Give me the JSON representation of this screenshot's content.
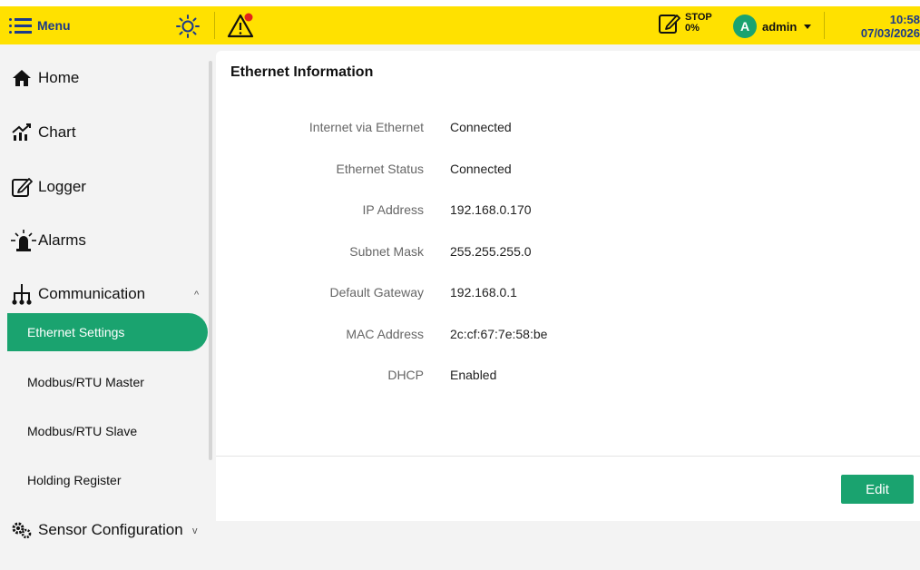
{
  "colors": {
    "topbar": "#ffe100",
    "accent": "#1aa36f",
    "menu_text": "#1c3a8a"
  },
  "header": {
    "menu_label": "Menu",
    "brightness_icon": "sun-icon",
    "alarm_icon": "warning-icon",
    "recording": {
      "status": "STOP",
      "percent": "0%"
    },
    "user": {
      "initial": "A",
      "name": "admin"
    },
    "time": "10:58",
    "date": "07/03/2026"
  },
  "sidebar": {
    "home": "Home",
    "chart": "Chart",
    "logger": "Logger",
    "alarms": "Alarms",
    "communication": "Communication",
    "sub_items": [
      "Ethernet Settings",
      "Modbus/RTU Master",
      "Modbus/RTU Slave",
      "Holding Register"
    ],
    "sensor_config": "Sensor Configuration"
  },
  "main": {
    "title": "Ethernet Information",
    "rows": [
      {
        "label": "Internet via Ethernet",
        "value": "Connected"
      },
      {
        "label": "Ethernet Status",
        "value": "Connected"
      },
      {
        "label": "IP Address",
        "value": "192.168.0.170"
      },
      {
        "label": "Subnet Mask",
        "value": "255.255.255.0"
      },
      {
        "label": "Default Gateway",
        "value": "192.168.0.1"
      },
      {
        "label": "MAC Address",
        "value": "2c:cf:67:7e:58:be"
      },
      {
        "label": "DHCP",
        "value": "Enabled"
      }
    ],
    "edit_label": "Edit"
  }
}
